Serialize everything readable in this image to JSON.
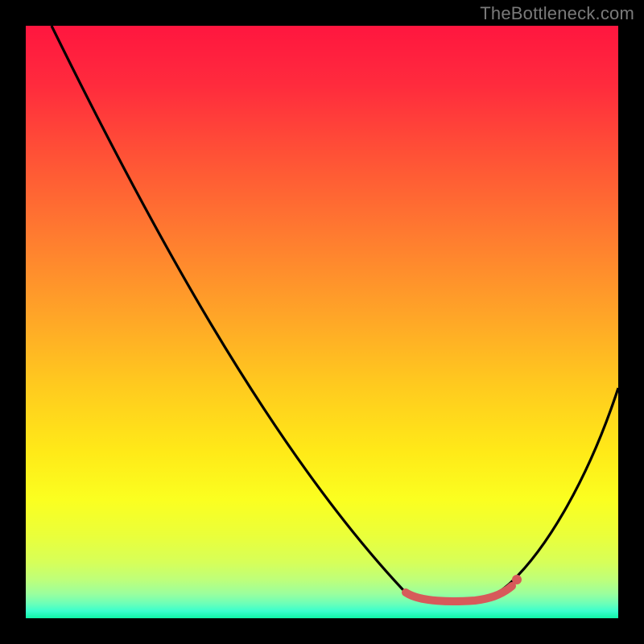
{
  "attribution": "TheBottleneck.com",
  "chart_data": {
    "type": "line",
    "title": "",
    "xlabel": "",
    "ylabel": "",
    "xlim": [
      0,
      100
    ],
    "ylim": [
      0,
      100
    ],
    "background_gradient": {
      "orientation": "vertical",
      "stops": [
        {
          "pos": 0.0,
          "color": "#ff163f"
        },
        {
          "pos": 0.35,
          "color": "#ff7a30"
        },
        {
          "pos": 0.6,
          "color": "#ffc81f"
        },
        {
          "pos": 0.8,
          "color": "#fbff20"
        },
        {
          "pos": 0.95,
          "color": "#9cff9c"
        },
        {
          "pos": 1.0,
          "color": "#10f5a8"
        }
      ]
    },
    "series": [
      {
        "name": "bottleneck-curve",
        "color": "#000000",
        "x": [
          4,
          15,
          30,
          45,
          58,
          64,
          68,
          72,
          76,
          80,
          84,
          90,
          100
        ],
        "y": [
          100,
          78,
          52,
          30,
          12,
          5,
          3,
          3,
          3,
          5,
          10,
          22,
          40
        ]
      }
    ],
    "highlight": {
      "name": "optimal-range",
      "color": "#d75a5a",
      "x": [
        64,
        68,
        72,
        76,
        80,
        83
      ],
      "y": [
        4,
        3,
        3,
        3,
        5,
        7
      ]
    }
  }
}
